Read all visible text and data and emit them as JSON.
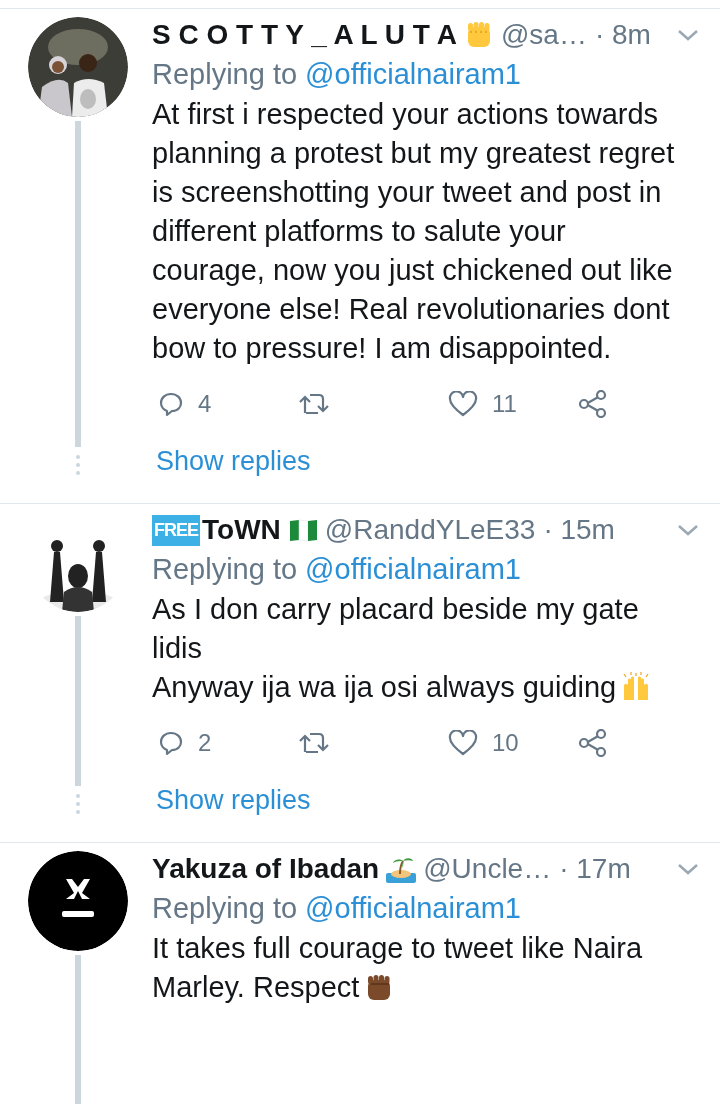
{
  "tweets": [
    {
      "avatar": {
        "kind": "picture"
      },
      "name": "S C O T T Y _ A L U T A",
      "name_emoji": {
        "kind": "fist"
      },
      "handle": "@sa…",
      "time": "· 8m",
      "replying_label": "Replying to",
      "replying_to": "@officialnairam1",
      "body_lines": [
        "At first i respected your actions towards",
        "planning a protest but my greatest regret",
        "is screenshotting your tweet and post in",
        "different platforms to salute your",
        "courage, now you just chickened out like",
        "everyone else! Real revolutionaries dont",
        "bow to pressure! I am disappointed."
      ],
      "reply_count": "4",
      "like_count": "11",
      "show_replies": "Show replies"
    },
    {
      "avatar": {
        "kind": "picture"
      },
      "name_badge": "FREE",
      "name": "ToWN",
      "name_emoji": {
        "kind": "flag"
      },
      "handle": "@RanddYLeE33",
      "time": "· 15m",
      "replying_label": "Replying to",
      "replying_to": "@officialnairam1",
      "body_lines": [
        "As I don carry placard beside my gate",
        "lidis",
        "Anyway ija wa ija osi always guiding"
      ],
      "body_emoji": {
        "kind": "raised-hands"
      },
      "reply_count": "2",
      "like_count": "10",
      "show_replies": "Show replies"
    },
    {
      "avatar": {
        "kind": "picture"
      },
      "name": "Yakuza of Ibadan",
      "name_emoji": {
        "kind": "island"
      },
      "handle": "@Uncle…",
      "time": "· 17m",
      "replying_label": "Replying to",
      "replying_to": "@officialnairam1",
      "body_lines": [
        "It takes full courage to tweet like Naira",
        "Marley. Respect"
      ],
      "body_emoji": {
        "kind": "dark-fist"
      }
    }
  ]
}
